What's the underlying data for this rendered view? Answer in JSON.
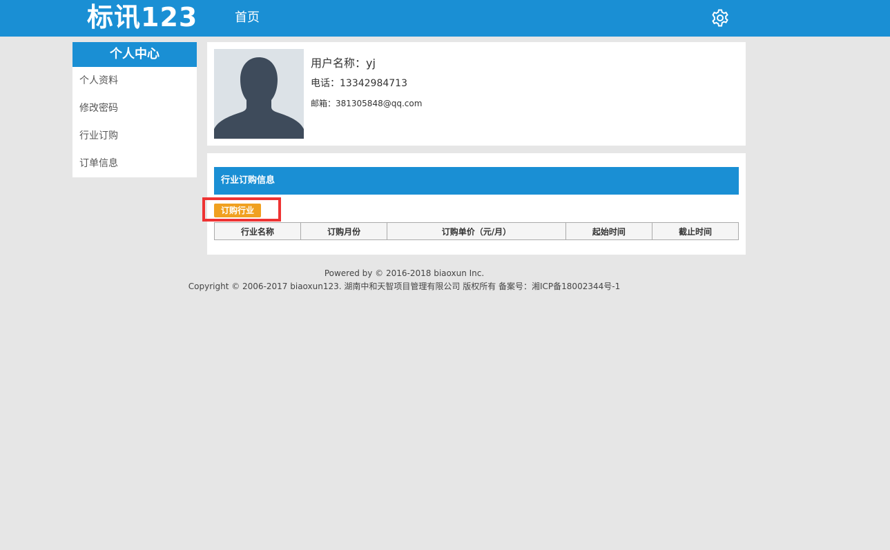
{
  "header": {
    "logo": "标讯123",
    "nav_home": "首页",
    "settings_icon": "gear-icon",
    "bg_color": "#1a8fd4"
  },
  "sidebar": {
    "title": "个人中心",
    "items": [
      {
        "label": "个人资料"
      },
      {
        "label": "修改密码"
      },
      {
        "label": "行业订购"
      },
      {
        "label": "订单信息"
      }
    ]
  },
  "profile": {
    "avatar_icon": "user-avatar-icon",
    "name_label": "用户名称：yj",
    "phone_label": "电话：13342984713",
    "email_label": "邮箱：381305848@qq.com"
  },
  "subscription": {
    "title": "行业订购信息",
    "subscribe_button": "订购行业",
    "button_color": "#f0a020",
    "columns": [
      "行业名称",
      "订购月份",
      "订购单价（元/月）",
      "起始时间",
      "截止时间"
    ],
    "rows": []
  },
  "footer": {
    "line1": "Powered by © 2016-2018 biaoxun Inc.",
    "line2": "Copyright © 2006-2017 biaoxun123. 湖南中和天智项目管理有限公司 版权所有  备案号：湘ICP备18002344号-1"
  }
}
